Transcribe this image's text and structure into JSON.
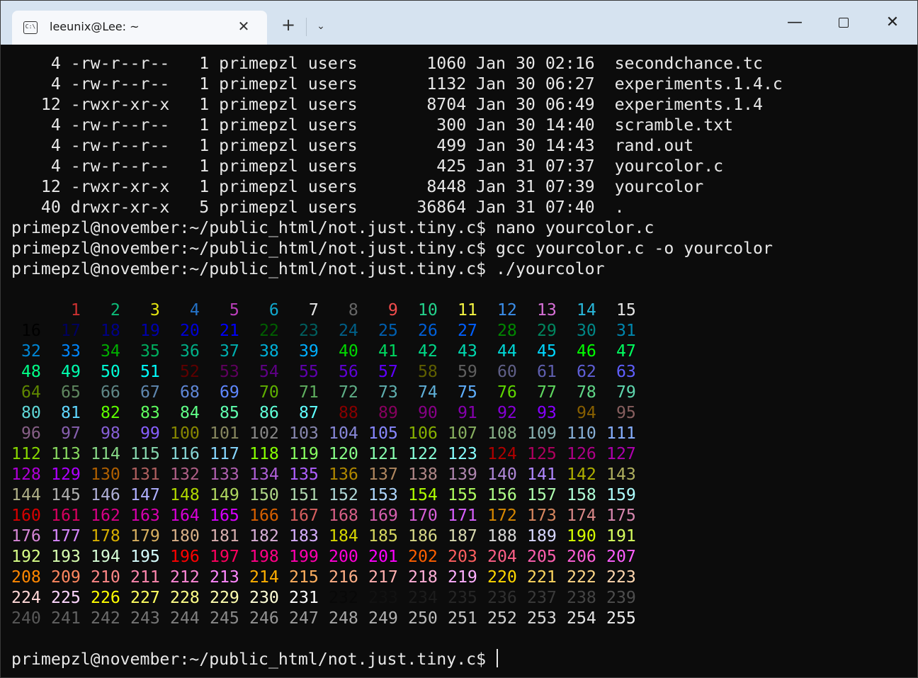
{
  "titlebar": {
    "tab_title": "leeunix@Lee: ~",
    "tab_icon": "C:\\",
    "close_tab": "✕",
    "new_tab": "+",
    "dropdown": "⌄",
    "minimize": "—",
    "close_window": "✕"
  },
  "terminal": {
    "listing": [
      {
        "blocks": "4",
        "perms": "-rw-r--r--",
        "links": "1",
        "owner": "primepzl",
        "group": "users",
        "size": "1060",
        "month": "Jan",
        "day": "30",
        "time": "02:16",
        "name": "secondchance.tc"
      },
      {
        "blocks": "4",
        "perms": "-rw-r--r--",
        "links": "1",
        "owner": "primepzl",
        "group": "users",
        "size": "1132",
        "month": "Jan",
        "day": "30",
        "time": "06:27",
        "name": "experiments.1.4.c"
      },
      {
        "blocks": "12",
        "perms": "-rwxr-xr-x",
        "links": "1",
        "owner": "primepzl",
        "group": "users",
        "size": "8704",
        "month": "Jan",
        "day": "30",
        "time": "06:49",
        "name": "experiments.1.4"
      },
      {
        "blocks": "4",
        "perms": "-rw-r--r--",
        "links": "1",
        "owner": "primepzl",
        "group": "users",
        "size": "300",
        "month": "Jan",
        "day": "30",
        "time": "14:40",
        "name": "scramble.txt"
      },
      {
        "blocks": "4",
        "perms": "-rw-r--r--",
        "links": "1",
        "owner": "primepzl",
        "group": "users",
        "size": "499",
        "month": "Jan",
        "day": "30",
        "time": "14:43",
        "name": "rand.out"
      },
      {
        "blocks": "4",
        "perms": "-rw-r--r--",
        "links": "1",
        "owner": "primepzl",
        "group": "users",
        "size": "425",
        "month": "Jan",
        "day": "31",
        "time": "07:37",
        "name": "yourcolor.c"
      },
      {
        "blocks": "12",
        "perms": "-rwxr-xr-x",
        "links": "1",
        "owner": "primepzl",
        "group": "users",
        "size": "8448",
        "month": "Jan",
        "day": "31",
        "time": "07:39",
        "name": "yourcolor"
      },
      {
        "blocks": "40",
        "perms": "drwxr-xr-x",
        "links": "5",
        "owner": "primepzl",
        "group": "users",
        "size": "36864",
        "month": "Jan",
        "day": "31",
        "time": "07:40",
        "name": "."
      }
    ],
    "prompt": "primepzl@november:~/public_html/not.just.tiny.c$",
    "commands": [
      "nano yourcolor.c",
      "gcc yourcolor.c -o yourcolor",
      "./yourcolor"
    ],
    "color_output": {
      "first_code": 1,
      "last_code": 255,
      "base16": [
        "#000000",
        "#cd3131",
        "#0dbc79",
        "#e5e510",
        "#2472c8",
        "#bc3fbc",
        "#11a8cd",
        "#e5e5e5",
        "#666666",
        "#f14c4c",
        "#23d18b",
        "#f5f543",
        "#3b8eea",
        "#d670d6",
        "#29b8db",
        "#e5e5e5"
      ]
    }
  }
}
